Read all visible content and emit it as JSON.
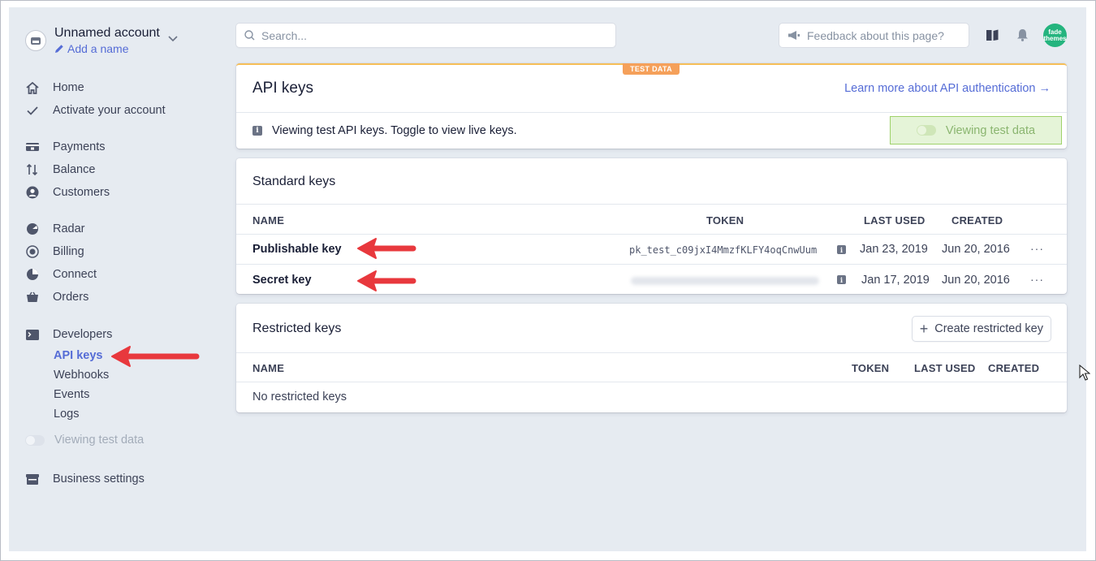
{
  "account": {
    "name": "Unnamed account",
    "add_name": "Add a name"
  },
  "nav": {
    "home": "Home",
    "activate": "Activate your account",
    "payments": "Payments",
    "balance": "Balance",
    "customers": "Customers",
    "radar": "Radar",
    "billing": "Billing",
    "connect": "Connect",
    "orders": "Orders",
    "developers": "Developers",
    "dev_items": [
      "API keys",
      "Webhooks",
      "Events",
      "Logs"
    ],
    "viewing_test": "Viewing test data",
    "business": "Business settings"
  },
  "topbar": {
    "search_placeholder": "Search...",
    "feedback": "Feedback about this page?",
    "avatar_text": "fade themes"
  },
  "api_card": {
    "badge": "TEST DATA",
    "title": "API keys",
    "learn_more": "Learn more about API authentication →",
    "info": "Viewing test API keys. Toggle to view live keys.",
    "toggle_label": "Viewing test data"
  },
  "standard": {
    "title": "Standard keys",
    "headers": {
      "name": "NAME",
      "token": "TOKEN",
      "last_used": "LAST USED",
      "created": "CREATED"
    },
    "rows": [
      {
        "name": "Publishable key",
        "token": "pk_test_c09jxI4MmzfKLFY4oqCnwUum",
        "last_used": "Jan 23, 2019",
        "created": "Jun 20, 2016",
        "more": "···"
      },
      {
        "name": "Secret key",
        "token": "",
        "last_used": "Jan 17, 2019",
        "created": "Jun 20, 2016",
        "more": "···"
      }
    ]
  },
  "restricted": {
    "title": "Restricted keys",
    "create": "Create restricted key",
    "headers": {
      "name": "NAME",
      "token": "TOKEN",
      "last_used": "LAST USED",
      "created": "CREATED"
    },
    "empty": "No restricted keys"
  },
  "colors": {
    "accent": "#556cd6",
    "annotation": "#e8383d",
    "test_badge": "#f5a05a",
    "background": "#e6ebf1"
  }
}
